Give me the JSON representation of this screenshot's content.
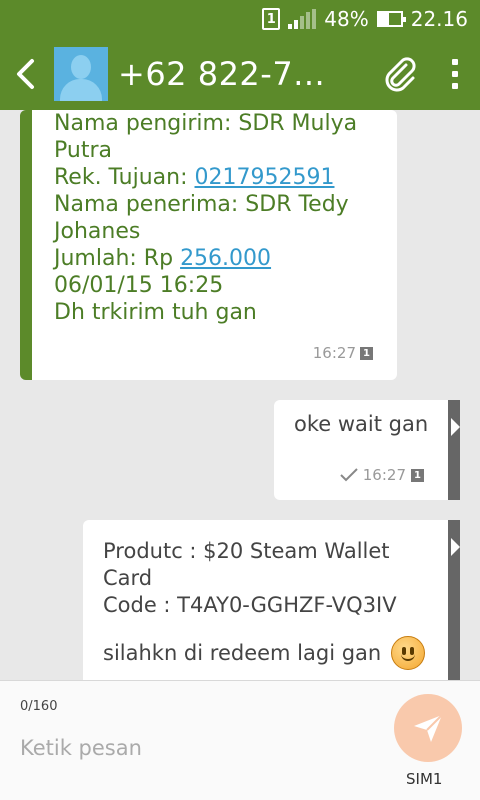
{
  "status_bar": {
    "sim_number": "1",
    "battery": "48%",
    "time": "22.16"
  },
  "header": {
    "title": "+62 822-7..."
  },
  "messages": {
    "incoming": {
      "lines": [
        "Nama pengirim: SDR Mulya",
        "Putra",
        "Rek. Tujuan: ",
        "Nama penerima: SDR Tedy",
        "Johanes",
        "Jumlah: Rp ",
        "06/01/15 16:25",
        "Dh trkirim tuh gan"
      ],
      "account_link": "0217952591",
      "amount_link": "256.000",
      "time": "16:27",
      "sim_badge": "1"
    },
    "outgoing_1": {
      "text": "oke wait gan",
      "time": "16:27",
      "sim_badge": "1"
    },
    "outgoing_2": {
      "line1": "Produtc : $20 Steam Wallet",
      "line2": "Card",
      "line3": "Code : T4AY0-GGHZF-VQ3IV",
      "line4": "silahkn di redeem lagi gan"
    }
  },
  "composer": {
    "counter": "0/160",
    "placeholder": "Ketik pesan",
    "sim_label": "SIM1"
  },
  "colors": {
    "accent": "#5c8a2a",
    "send_button": "#f9c9ac"
  }
}
